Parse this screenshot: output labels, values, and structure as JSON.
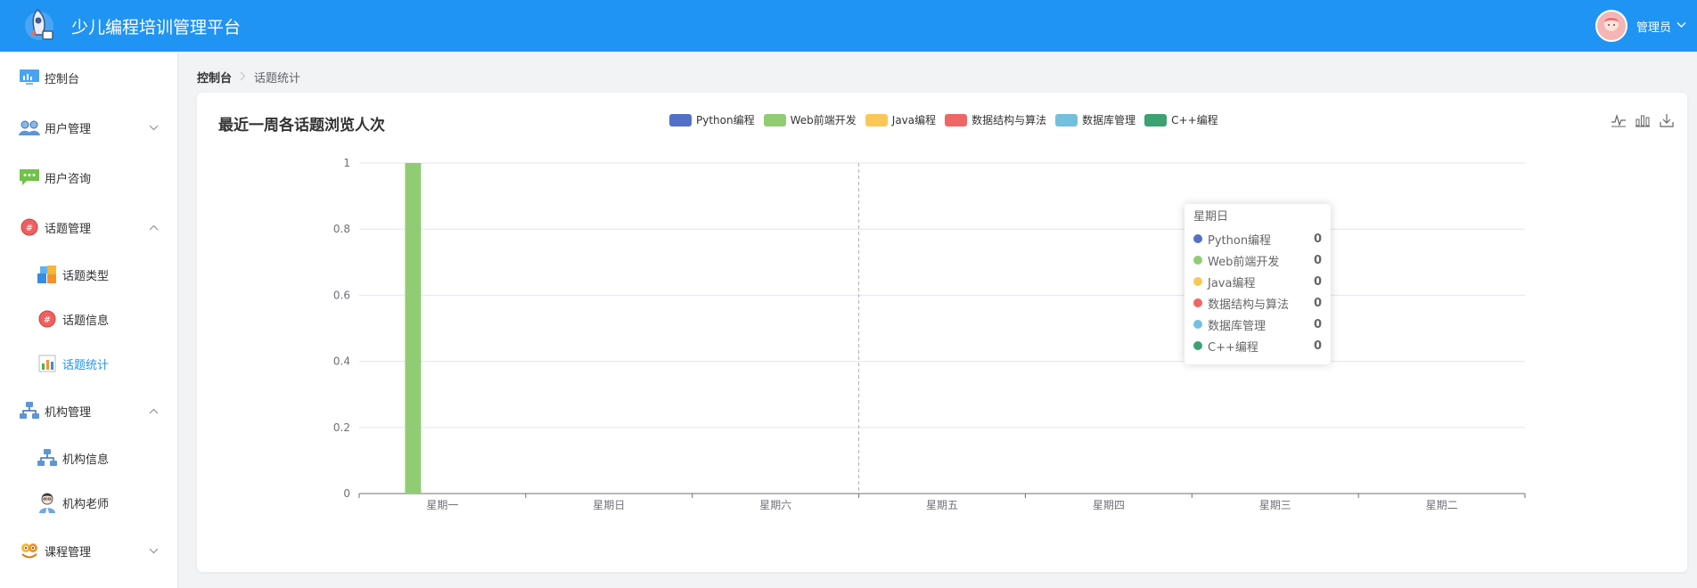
{
  "header": {
    "title": "少儿编程培训管理平台",
    "admin_name": "管理员"
  },
  "sidebar": {
    "items": [
      {
        "label": "控制台",
        "icon": "dashboard-icon"
      },
      {
        "label": "用户管理",
        "icon": "users-icon"
      },
      {
        "label": "用户咨询",
        "icon": "chat-icon"
      },
      {
        "label": "话题管理",
        "icon": "hash-icon"
      },
      {
        "label": "机构管理",
        "icon": "org-icon"
      },
      {
        "label": "课程管理",
        "icon": "course-icon"
      }
    ],
    "sub_topic": [
      {
        "label": "话题类型",
        "icon": "blocks-icon"
      },
      {
        "label": "话题信息",
        "icon": "hash-icon"
      },
      {
        "label": "话题统计",
        "icon": "stats-icon"
      }
    ],
    "sub_org": [
      {
        "label": "机构信息",
        "icon": "org-icon"
      },
      {
        "label": "机构老师",
        "icon": "teacher-icon"
      }
    ]
  },
  "breadcrumb": {
    "home": "控制台",
    "current": "话题统计"
  },
  "chart_data": {
    "type": "bar",
    "title": "最近一周各话题浏览人次",
    "categories": [
      "星期一",
      "星期日",
      "星期六",
      "星期五",
      "星期四",
      "星期三",
      "星期二"
    ],
    "ylim": [
      0,
      1
    ],
    "yticks": [
      "0",
      "0.2",
      "0.4",
      "0.6",
      "0.8",
      "1"
    ],
    "grid": true,
    "legend_position": "top",
    "series": [
      {
        "name": "Python编程",
        "color": "#5470c6",
        "values": [
          0,
          0,
          0,
          0,
          0,
          0,
          0
        ]
      },
      {
        "name": "Web前端开发",
        "color": "#91cc75",
        "values": [
          1,
          0,
          0,
          0,
          0,
          0,
          0
        ]
      },
      {
        "name": "Java编程",
        "color": "#fac858",
        "values": [
          0,
          0,
          0,
          0,
          0,
          0,
          0
        ]
      },
      {
        "name": "数据结构与算法",
        "color": "#ee6666",
        "values": [
          0,
          0,
          0,
          0,
          0,
          0,
          0
        ]
      },
      {
        "name": "数据库管理",
        "color": "#73c0de",
        "values": [
          0,
          0,
          0,
          0,
          0,
          0,
          0
        ]
      },
      {
        "name": "C++编程",
        "color": "#3ba272",
        "values": [
          0,
          0,
          0,
          0,
          0,
          0,
          0
        ]
      }
    ]
  },
  "tooltip": {
    "title": "星期日",
    "rows": [
      {
        "name": "Python编程",
        "value": "0",
        "color": "#5470c6"
      },
      {
        "name": "Web前端开发",
        "value": "0",
        "color": "#91cc75"
      },
      {
        "name": "Java编程",
        "value": "0",
        "color": "#fac858"
      },
      {
        "name": "数据结构与算法",
        "value": "0",
        "color": "#ee6666"
      },
      {
        "name": "数据库管理",
        "value": "0",
        "color": "#73c0de"
      },
      {
        "name": "C++编程",
        "value": "0",
        "color": "#3ba272"
      }
    ]
  },
  "toolbox": [
    {
      "icon": "line-chart-icon"
    },
    {
      "icon": "bar-chart-icon"
    },
    {
      "icon": "download-icon"
    }
  ]
}
